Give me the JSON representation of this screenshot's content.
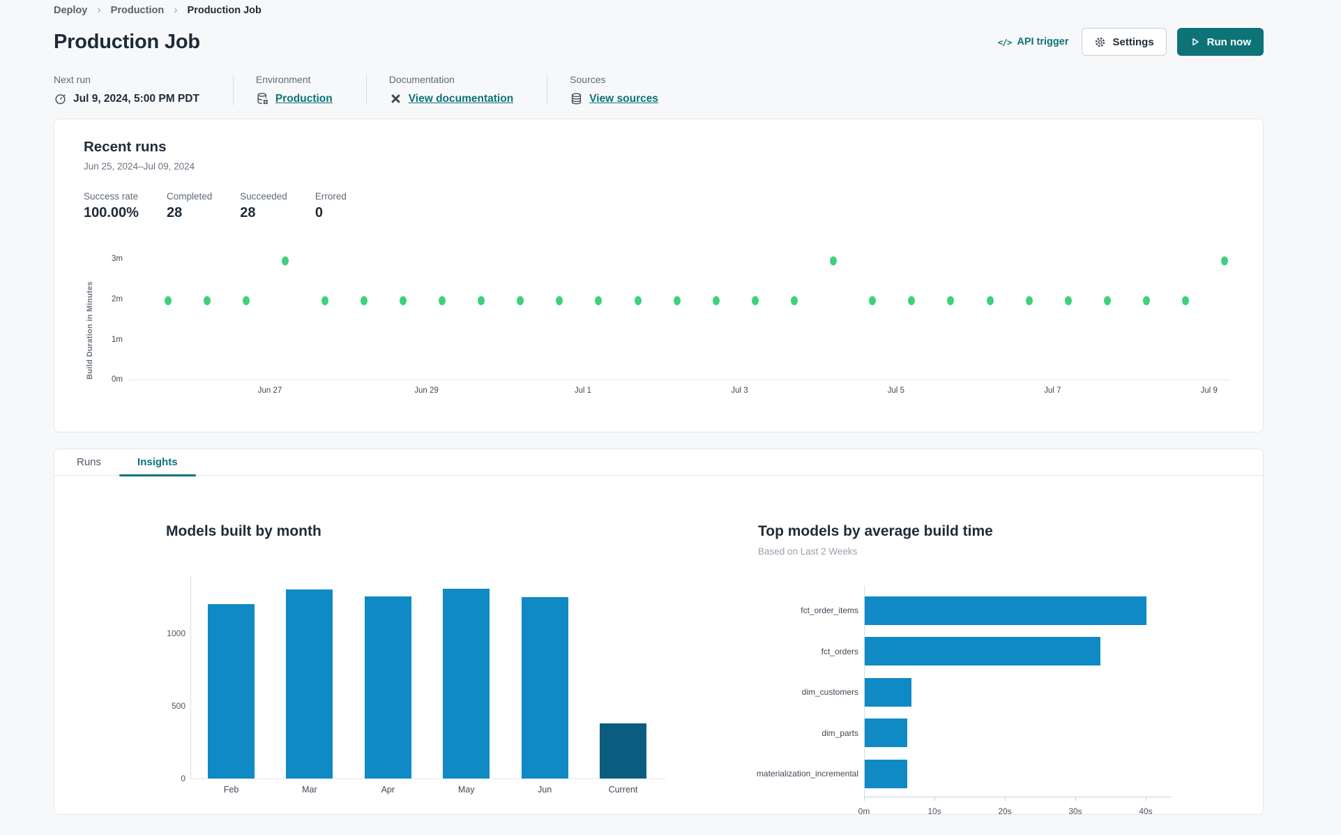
{
  "breadcrumb": {
    "items": [
      "Deploy",
      "Production",
      "Production Job"
    ]
  },
  "header": {
    "title": "Production Job",
    "api_trigger": "API trigger",
    "settings": "Settings",
    "run_now": "Run now"
  },
  "info_bar": {
    "next_run_label": "Next run",
    "next_run_value": "Jul 9, 2024, 5:00 PM PDT",
    "environment_label": "Environment",
    "environment_value": "Production",
    "documentation_label": "Documentation",
    "documentation_value": "View documentation",
    "sources_label": "Sources",
    "sources_value": "View sources"
  },
  "recent_runs": {
    "title": "Recent runs",
    "date_range": "Jun 25, 2024–Jul 09, 2024",
    "stats": [
      {
        "label": "Success rate",
        "value": "100.00%"
      },
      {
        "label": "Completed",
        "value": "28"
      },
      {
        "label": "Succeeded",
        "value": "28"
      },
      {
        "label": "Errored",
        "value": "0"
      }
    ]
  },
  "tabs": {
    "runs": "Runs",
    "insights": "Insights"
  },
  "colors": {
    "teal_accent": "#0d7377",
    "run_dot_green": "#3fd07d",
    "bar_blue": "#0f8ac5",
    "bar_navy": "#0b5d80",
    "dark_text": "#1f2b38",
    "gray_text": "#5d6a75"
  },
  "chart_data": [
    {
      "type": "scatter",
      "name": "recent-runs-build-duration",
      "ylabel": "Build Duration in Minutes",
      "x_unit": "days since Jun 25, 2024",
      "points": {
        "t": [
          0.7,
          1.2,
          1.7,
          2.2,
          2.7,
          3.2,
          3.7,
          4.2,
          4.7,
          5.2,
          5.7,
          6.2,
          6.7,
          7.2,
          7.7,
          8.2,
          8.7,
          9.2,
          9.7,
          10.2,
          10.7,
          11.2,
          11.7,
          12.2,
          12.7,
          13.2,
          13.7,
          14.2
        ],
        "minutes": [
          1.97,
          1.97,
          1.97,
          2.96,
          1.97,
          1.97,
          1.97,
          1.97,
          1.97,
          1.97,
          1.97,
          1.97,
          1.97,
          1.97,
          1.97,
          1.97,
          1.97,
          2.96,
          1.97,
          1.97,
          1.97,
          1.97,
          1.97,
          1.97,
          1.97,
          1.97,
          1.97,
          2.96
        ]
      },
      "y_ticks": [
        {
          "v": 0,
          "label": "0m"
        },
        {
          "v": 1,
          "label": "1m"
        },
        {
          "v": 2,
          "label": "2m"
        },
        {
          "v": 3,
          "label": "3m"
        }
      ],
      "x_ticks": [
        {
          "t": 2,
          "label": "Jun 27"
        },
        {
          "t": 4,
          "label": "Jun 29"
        },
        {
          "t": 6,
          "label": "Jul 1"
        },
        {
          "t": 8,
          "label": "Jul 3"
        },
        {
          "t": 10,
          "label": "Jul 5"
        },
        {
          "t": 12,
          "label": "Jul 7"
        },
        {
          "t": 14,
          "label": "Jul 9"
        }
      ],
      "xlim": [
        0.2,
        14.26
      ],
      "ylim": [
        0,
        3.13
      ],
      "grid": false,
      "point_color": "#3fd07d"
    },
    {
      "type": "bar",
      "title": "Models built by month",
      "categories": [
        "Feb",
        "Mar",
        "Apr",
        "May",
        "Jun",
        "Current"
      ],
      "values": [
        1205,
        1305,
        1255,
        1310,
        1250,
        380
      ],
      "bar_colors": [
        "#0f8ac5",
        "#0f8ac5",
        "#0f8ac5",
        "#0f8ac5",
        "#0f8ac5",
        "#0b5d80"
      ],
      "y_ticks": [
        0,
        500,
        1000
      ],
      "ylim": [
        0,
        1400
      ],
      "grid": false
    },
    {
      "type": "horizontal-bar",
      "title": "Top models by average build time",
      "subtitle": "Based on Last 2 Weeks",
      "categories": [
        "fct_order_items",
        "fct_orders",
        "dim_customers",
        "dim_parts",
        "materialization_incremental"
      ],
      "values_seconds": [
        40,
        33.5,
        6.6,
        6,
        6
      ],
      "x_ticks": [
        {
          "v": 0,
          "label": "0m"
        },
        {
          "v": 10,
          "label": "10s"
        },
        {
          "v": 20,
          "label": "20s"
        },
        {
          "v": 30,
          "label": "30s"
        },
        {
          "v": 40,
          "label": "40s"
        }
      ],
      "xlim": [
        0,
        43.5
      ],
      "grid": false,
      "bar_color": "#0f8ac5"
    }
  ]
}
